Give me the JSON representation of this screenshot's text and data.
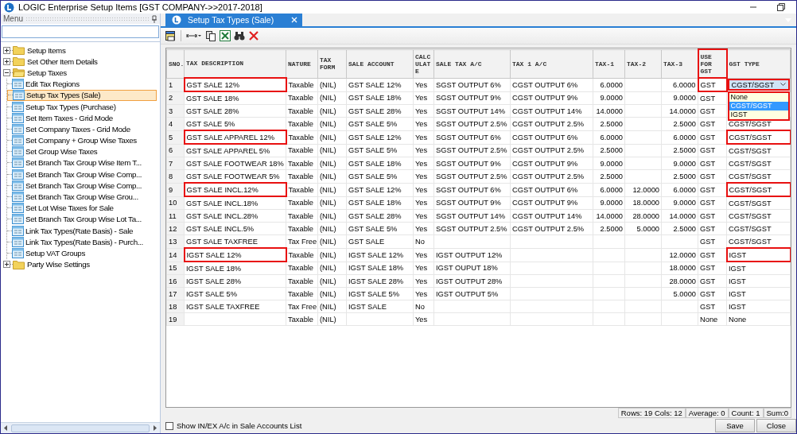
{
  "window": {
    "title": "LOGIC Enterprise Setup Items  [GST COMPANY->>2017-2018]"
  },
  "menu": {
    "title": "Menu",
    "tree": [
      {
        "kind": "folder",
        "label": "Setup Items",
        "expanded": false,
        "selected": false
      },
      {
        "kind": "folder",
        "label": "Set Other Item Details",
        "expanded": false,
        "selected": false
      },
      {
        "kind": "folder",
        "label": "Setup Taxes",
        "expanded": true,
        "selected": false,
        "children": [
          {
            "kind": "form",
            "label": "Edit Tax Regions",
            "selected": false
          },
          {
            "kind": "form",
            "label": "Setup Tax Types (Sale)",
            "selected": true
          },
          {
            "kind": "form",
            "label": "Setup Tax Types (Purchase)",
            "selected": false
          },
          {
            "kind": "form",
            "label": "Set Item Taxes - Grid Mode",
            "selected": false
          },
          {
            "kind": "form",
            "label": "Set Company Taxes - Grid Mode",
            "selected": false
          },
          {
            "kind": "form",
            "label": "Set Company + Group Wise Taxes",
            "selected": false
          },
          {
            "kind": "form",
            "label": "Set Group Wise Taxes",
            "selected": false
          },
          {
            "kind": "form",
            "label": "Set Branch Tax Group Wise Item T...",
            "selected": false
          },
          {
            "kind": "form",
            "label": "Set Branch Tax Group Wise Comp...",
            "selected": false
          },
          {
            "kind": "form",
            "label": "Set Branch Tax Group Wise Comp...",
            "selected": false
          },
          {
            "kind": "form",
            "label": "Set Branch Tax Group Wise Grou...",
            "selected": false
          },
          {
            "kind": "form",
            "label": "Set Lot Wise Taxes for Sale",
            "selected": false
          },
          {
            "kind": "form",
            "label": "Set Branch Tax Group Wise Lot Ta...",
            "selected": false
          },
          {
            "kind": "form",
            "label": "Link Tax Types(Rate Basis) - Sale",
            "selected": false
          },
          {
            "kind": "form",
            "label": "Link Tax Types(Rate Basis) - Purch...",
            "selected": false
          },
          {
            "kind": "form",
            "label": "Setup VAT Groups",
            "selected": false
          }
        ]
      },
      {
        "kind": "folder",
        "label": "Party Wise Settings",
        "expanded": false,
        "selected": false
      }
    ]
  },
  "tabs": [
    {
      "label": "Setup Tax Types (Sale)",
      "selected": true
    }
  ],
  "table": {
    "columns": [
      {
        "label": "SNO.",
        "highlighted": false
      },
      {
        "label": "TAX DESCRIPTION",
        "highlighted": false
      },
      {
        "label": "NATURE",
        "highlighted": false
      },
      {
        "label": "TAX FORM",
        "highlighted": false
      },
      {
        "label": "SALE ACCOUNT",
        "highlighted": false
      },
      {
        "label": "CALC ULAT E",
        "highlighted": false
      },
      {
        "label": "SALE TAX A/C",
        "highlighted": false
      },
      {
        "label": "TAX 1 A/C",
        "highlighted": false
      },
      {
        "label": "TAX-1",
        "highlighted": false
      },
      {
        "label": "TAX-2",
        "highlighted": false
      },
      {
        "label": "TAX-3",
        "highlighted": false
      },
      {
        "label": "USE FOR GST",
        "highlighted": true
      },
      {
        "label": "GST TYPE",
        "highlighted": false
      }
    ],
    "rows": [
      {
        "cells": [
          {
            "text": "1",
            "highlighted": false
          },
          {
            "text": "GST SALE 12%",
            "highlighted": true
          },
          {
            "text": "Taxable",
            "highlighted": false
          },
          {
            "text": "(NIL)",
            "highlighted": false
          },
          {
            "text": "GST SALE 12%",
            "highlighted": false
          },
          {
            "text": "Yes",
            "highlighted": false
          },
          {
            "text": "SGST OUTPUT 6%",
            "highlighted": false
          },
          {
            "text": "CGST OUTPUT 6%",
            "highlighted": false
          },
          {
            "text": "6.0000",
            "highlighted": false
          },
          {
            "highlighted": false
          },
          {
            "text": "6.0000",
            "highlighted": false
          },
          {
            "text": "GST",
            "highlighted": true
          },
          {
            "text": "CGST/SGST",
            "highlighted": true,
            "options": [
              {
                "label": "None",
                "selected": false
              },
              {
                "label": "CGST/SGST",
                "selected": true
              },
              {
                "label": "IGST",
                "selected": false
              }
            ]
          }
        ]
      },
      {
        "cells": [
          {
            "text": "2",
            "highlighted": false
          },
          {
            "text": "GST SALE 18%",
            "highlighted": false
          },
          {
            "text": "Taxable",
            "highlighted": false
          },
          {
            "text": "(NIL)",
            "highlighted": false
          },
          {
            "text": "GST SALE 18%",
            "highlighted": false
          },
          {
            "text": "Yes",
            "highlighted": false
          },
          {
            "text": "SGST OUTPUT 9%",
            "highlighted": false
          },
          {
            "text": "CGST OUTPUT 9%",
            "highlighted": false
          },
          {
            "text": "9.0000",
            "highlighted": false
          },
          {
            "highlighted": false
          },
          {
            "text": "9.0000",
            "highlighted": false
          },
          {
            "text": "GST",
            "highlighted": false
          }
        ]
      },
      {
        "cells": [
          {
            "text": "3",
            "highlighted": false
          },
          {
            "text": "GST SALE 28%",
            "highlighted": false
          },
          {
            "text": "Taxable",
            "highlighted": false
          },
          {
            "text": "(NIL)",
            "highlighted": false
          },
          {
            "text": "GST SALE 28%",
            "highlighted": false
          },
          {
            "text": "Yes",
            "highlighted": false
          },
          {
            "text": "SGST OUTPUT 14%",
            "highlighted": false
          },
          {
            "text": "CGST OUTPUT 14%",
            "highlighted": false
          },
          {
            "text": "14.0000",
            "highlighted": false
          },
          {
            "highlighted": false
          },
          {
            "text": "14.0000",
            "highlighted": false
          },
          {
            "text": "GST",
            "highlighted": false
          }
        ]
      },
      {
        "cells": [
          {
            "text": "4",
            "highlighted": false
          },
          {
            "text": "GST SALE 5%",
            "highlighted": false
          },
          {
            "text": "Taxable",
            "highlighted": false
          },
          {
            "text": "(NIL)",
            "highlighted": false
          },
          {
            "text": "GST SALE 5%",
            "highlighted": false
          },
          {
            "text": "Yes",
            "highlighted": false
          },
          {
            "text": "SGST OUTPUT 2.5%",
            "highlighted": false
          },
          {
            "text": "CGST OUTPUT 2.5%",
            "highlighted": false
          },
          {
            "text": "2.5000",
            "highlighted": false
          },
          {
            "highlighted": false
          },
          {
            "text": "2.5000",
            "highlighted": false
          },
          {
            "text": "GST",
            "highlighted": false
          },
          {
            "text": "CGST/SGST",
            "highlighted": false
          }
        ]
      },
      {
        "cells": [
          {
            "text": "5",
            "highlighted": false
          },
          {
            "text": "GST SALE APPAREL 12%",
            "highlighted": true
          },
          {
            "text": "Taxable",
            "highlighted": false
          },
          {
            "text": "(NIL)",
            "highlighted": false
          },
          {
            "text": "GST SALE 12%",
            "highlighted": false
          },
          {
            "text": "Yes",
            "highlighted": false
          },
          {
            "text": "SGST OUTPUT 6%",
            "highlighted": false
          },
          {
            "text": "CGST OUTPUT 6%",
            "highlighted": false
          },
          {
            "text": "6.0000",
            "highlighted": false
          },
          {
            "highlighted": false
          },
          {
            "text": "6.0000",
            "highlighted": false
          },
          {
            "text": "GST",
            "highlighted": false
          },
          {
            "text": "CGST/SGST",
            "highlighted": true
          }
        ]
      },
      {
        "cells": [
          {
            "text": "6",
            "highlighted": false
          },
          {
            "text": "GST SALE APPAREL 5%",
            "highlighted": false
          },
          {
            "text": "Taxable",
            "highlighted": false
          },
          {
            "text": "(NIL)",
            "highlighted": false
          },
          {
            "text": "GST SALE 5%",
            "highlighted": false
          },
          {
            "text": "Yes",
            "highlighted": false
          },
          {
            "text": "SGST OUTPUT 2.5%",
            "highlighted": false
          },
          {
            "text": "CGST OUTPUT 2.5%",
            "highlighted": false
          },
          {
            "text": "2.5000",
            "highlighted": false
          },
          {
            "highlighted": false
          },
          {
            "text": "2.5000",
            "highlighted": false
          },
          {
            "text": "GST",
            "highlighted": false
          },
          {
            "text": "CGST/SGST",
            "highlighted": false
          }
        ]
      },
      {
        "cells": [
          {
            "text": "7",
            "highlighted": false
          },
          {
            "text": "GST SALE FOOTWEAR 18%",
            "highlighted": false
          },
          {
            "text": "Taxable",
            "highlighted": false
          },
          {
            "text": "(NIL)",
            "highlighted": false
          },
          {
            "text": "GST SALE 18%",
            "highlighted": false
          },
          {
            "text": "Yes",
            "highlighted": false
          },
          {
            "text": "SGST OUTPUT 9%",
            "highlighted": false
          },
          {
            "text": "CGST OUTPUT 9%",
            "highlighted": false
          },
          {
            "text": "9.0000",
            "highlighted": false
          },
          {
            "highlighted": false
          },
          {
            "text": "9.0000",
            "highlighted": false
          },
          {
            "text": "GST",
            "highlighted": false
          },
          {
            "text": "CGST/SGST",
            "highlighted": false
          }
        ]
      },
      {
        "cells": [
          {
            "text": "8",
            "highlighted": false
          },
          {
            "text": "GST SALE FOOTWEAR 5%",
            "highlighted": false
          },
          {
            "text": "Taxable",
            "highlighted": false
          },
          {
            "text": "(NIL)",
            "highlighted": false
          },
          {
            "text": "GST SALE 5%",
            "highlighted": false
          },
          {
            "text": "Yes",
            "highlighted": false
          },
          {
            "text": "SGST OUTPUT 2.5%",
            "highlighted": false
          },
          {
            "text": "CGST OUTPUT 2.5%",
            "highlighted": false
          },
          {
            "text": "2.5000",
            "highlighted": false
          },
          {
            "highlighted": false
          },
          {
            "text": "2.5000",
            "highlighted": false
          },
          {
            "text": "GST",
            "highlighted": false
          },
          {
            "text": "CGST/SGST",
            "highlighted": false
          }
        ]
      },
      {
        "cells": [
          {
            "text": "9",
            "highlighted": false
          },
          {
            "text": "GST SALE INCL.12%",
            "highlighted": true
          },
          {
            "text": "Taxable",
            "highlighted": false
          },
          {
            "text": "(NIL)",
            "highlighted": false
          },
          {
            "text": "GST SALE 12%",
            "highlighted": false
          },
          {
            "text": "Yes",
            "highlighted": false
          },
          {
            "text": "SGST OUTPUT 6%",
            "highlighted": false
          },
          {
            "text": "CGST OUTPUT 6%",
            "highlighted": false
          },
          {
            "text": "6.0000",
            "highlighted": false
          },
          {
            "text": "12.0000",
            "highlighted": false
          },
          {
            "text": "6.0000",
            "highlighted": false
          },
          {
            "text": "GST",
            "highlighted": false
          },
          {
            "text": "CGST/SGST",
            "highlighted": true
          }
        ]
      },
      {
        "cells": [
          {
            "text": "10",
            "highlighted": false
          },
          {
            "text": "GST SALE INCL.18%",
            "highlighted": false
          },
          {
            "text": "Taxable",
            "highlighted": false
          },
          {
            "text": "(NIL)",
            "highlighted": false
          },
          {
            "text": "GST SALE 18%",
            "highlighted": false
          },
          {
            "text": "Yes",
            "highlighted": false
          },
          {
            "text": "SGST OUTPUT 9%",
            "highlighted": false
          },
          {
            "text": "CGST OUTPUT 9%",
            "highlighted": false
          },
          {
            "text": "9.0000",
            "highlighted": false
          },
          {
            "text": "18.0000",
            "highlighted": false
          },
          {
            "text": "9.0000",
            "highlighted": false
          },
          {
            "text": "GST",
            "highlighted": false
          },
          {
            "text": "CGST/SGST",
            "highlighted": false
          }
        ]
      },
      {
        "cells": [
          {
            "text": "11",
            "highlighted": false
          },
          {
            "text": "GST SALE INCL.28%",
            "highlighted": false
          },
          {
            "text": "Taxable",
            "highlighted": false
          },
          {
            "text": "(NIL)",
            "highlighted": false
          },
          {
            "text": "GST SALE 28%",
            "highlighted": false
          },
          {
            "text": "Yes",
            "highlighted": false
          },
          {
            "text": "SGST OUTPUT 14%",
            "highlighted": false
          },
          {
            "text": "CGST OUTPUT 14%",
            "highlighted": false
          },
          {
            "text": "14.0000",
            "highlighted": false
          },
          {
            "text": "28.0000",
            "highlighted": false
          },
          {
            "text": "14.0000",
            "highlighted": false
          },
          {
            "text": "GST",
            "highlighted": false
          },
          {
            "text": "CGST/SGST",
            "highlighted": false
          }
        ]
      },
      {
        "cells": [
          {
            "text": "12",
            "highlighted": false
          },
          {
            "text": "GST SALE INCL.5%",
            "highlighted": false
          },
          {
            "text": "Taxable",
            "highlighted": false
          },
          {
            "text": "(NIL)",
            "highlighted": false
          },
          {
            "text": "GST SALE 5%",
            "highlighted": false
          },
          {
            "text": "Yes",
            "highlighted": false
          },
          {
            "text": "SGST OUTPUT 2.5%",
            "highlighted": false
          },
          {
            "text": "CGST OUTPUT 2.5%",
            "highlighted": false
          },
          {
            "text": "2.5000",
            "highlighted": false
          },
          {
            "text": "5.0000",
            "highlighted": false
          },
          {
            "text": "2.5000",
            "highlighted": false
          },
          {
            "text": "GST",
            "highlighted": false
          },
          {
            "text": "CGST/SGST",
            "highlighted": false
          }
        ]
      },
      {
        "cells": [
          {
            "text": "13",
            "highlighted": false
          },
          {
            "text": "GST SALE TAXFREE",
            "highlighted": false
          },
          {
            "text": "Tax Free",
            "highlighted": false
          },
          {
            "text": "(NIL)",
            "highlighted": false
          },
          {
            "text": "GST SALE",
            "highlighted": false
          },
          {
            "text": "No",
            "highlighted": false
          },
          {
            "highlighted": false
          },
          {
            "highlighted": false
          },
          {
            "highlighted": false
          },
          {
            "highlighted": false
          },
          {
            "highlighted": false
          },
          {
            "text": "GST",
            "highlighted": false
          },
          {
            "text": "CGST/SGST",
            "highlighted": false
          }
        ]
      },
      {
        "cells": [
          {
            "text": "14",
            "highlighted": false
          },
          {
            "text": "IGST SALE 12%",
            "highlighted": true
          },
          {
            "text": "Taxable",
            "highlighted": false
          },
          {
            "text": "(NIL)",
            "highlighted": false
          },
          {
            "text": "IGST SALE 12%",
            "highlighted": false
          },
          {
            "text": "Yes",
            "highlighted": false
          },
          {
            "text": "IGST OUTPUT 12%",
            "highlighted": false
          },
          {
            "highlighted": false
          },
          {
            "highlighted": false
          },
          {
            "highlighted": false
          },
          {
            "text": "12.0000",
            "highlighted": false
          },
          {
            "text": "GST",
            "highlighted": false
          },
          {
            "text": "IGST",
            "highlighted": true
          }
        ]
      },
      {
        "cells": [
          {
            "text": "15",
            "highlighted": false
          },
          {
            "text": "IGST SALE 18%",
            "highlighted": false
          },
          {
            "text": "Taxable",
            "highlighted": false
          },
          {
            "text": "(NIL)",
            "highlighted": false
          },
          {
            "text": "IGST SALE 18%",
            "highlighted": false
          },
          {
            "text": "Yes",
            "highlighted": false
          },
          {
            "text": "IGST OUPUT 18%",
            "highlighted": false
          },
          {
            "highlighted": false
          },
          {
            "highlighted": false
          },
          {
            "highlighted": false
          },
          {
            "text": "18.0000",
            "highlighted": false
          },
          {
            "text": "GST",
            "highlighted": false
          },
          {
            "text": "IGST",
            "highlighted": false
          }
        ]
      },
      {
        "cells": [
          {
            "text": "16",
            "highlighted": false
          },
          {
            "text": "IGST SALE 28%",
            "highlighted": false
          },
          {
            "text": "Taxable",
            "highlighted": false
          },
          {
            "text": "(NIL)",
            "highlighted": false
          },
          {
            "text": "IGST SALE 28%",
            "highlighted": false
          },
          {
            "text": "Yes",
            "highlighted": false
          },
          {
            "text": "IGST OUTPUT 28%",
            "highlighted": false
          },
          {
            "highlighted": false
          },
          {
            "highlighted": false
          },
          {
            "highlighted": false
          },
          {
            "text": "28.0000",
            "highlighted": false
          },
          {
            "text": "GST",
            "highlighted": false
          },
          {
            "text": "IGST",
            "highlighted": false
          }
        ]
      },
      {
        "cells": [
          {
            "text": "17",
            "highlighted": false
          },
          {
            "text": "IGST SALE 5%",
            "highlighted": false
          },
          {
            "text": "Taxable",
            "highlighted": false
          },
          {
            "text": "(NIL)",
            "highlighted": false
          },
          {
            "text": "IGST SALE 5%",
            "highlighted": false
          },
          {
            "text": "Yes",
            "highlighted": false
          },
          {
            "text": "IGST OUTPUT 5%",
            "highlighted": false
          },
          {
            "highlighted": false
          },
          {
            "highlighted": false
          },
          {
            "highlighted": false
          },
          {
            "text": "5.0000",
            "highlighted": false
          },
          {
            "text": "GST",
            "highlighted": false
          },
          {
            "text": "IGST",
            "highlighted": false
          }
        ]
      },
      {
        "cells": [
          {
            "text": "18",
            "highlighted": false
          },
          {
            "text": "IGST SALE TAXFREE",
            "highlighted": false
          },
          {
            "text": "Tax Free",
            "highlighted": false
          },
          {
            "text": "(NIL)",
            "highlighted": false
          },
          {
            "text": "IGST SALE",
            "highlighted": false
          },
          {
            "text": "No",
            "highlighted": false
          },
          {
            "highlighted": false
          },
          {
            "highlighted": false
          },
          {
            "highlighted": false
          },
          {
            "highlighted": false
          },
          {
            "highlighted": false
          },
          {
            "text": "GST",
            "highlighted": false
          },
          {
            "text": "IGST",
            "highlighted": false
          }
        ]
      },
      {
        "cells": [
          {
            "text": "19",
            "highlighted": false
          },
          {
            "highlighted": false
          },
          {
            "text": "Taxable",
            "highlighted": false
          },
          {
            "text": "(NIL)",
            "highlighted": false
          },
          {
            "highlighted": false
          },
          {
            "text": "Yes",
            "highlighted": false
          },
          {
            "highlighted": false
          },
          {
            "highlighted": false
          },
          {
            "highlighted": false
          },
          {
            "highlighted": false
          },
          {
            "highlighted": false
          },
          {
            "text": "None",
            "highlighted": false
          },
          {
            "text": "None",
            "highlighted": false
          }
        ]
      }
    ]
  },
  "status_bar": [
    "Rows: 19  Cols: 12",
    "Average: 0",
    "Count: 1",
    "Sum:0"
  ],
  "options": [
    {
      "label": "Show IN/EX A/c in Sale Accounts List",
      "checked": false
    }
  ],
  "buttons": [
    "Save",
    "Close"
  ]
}
